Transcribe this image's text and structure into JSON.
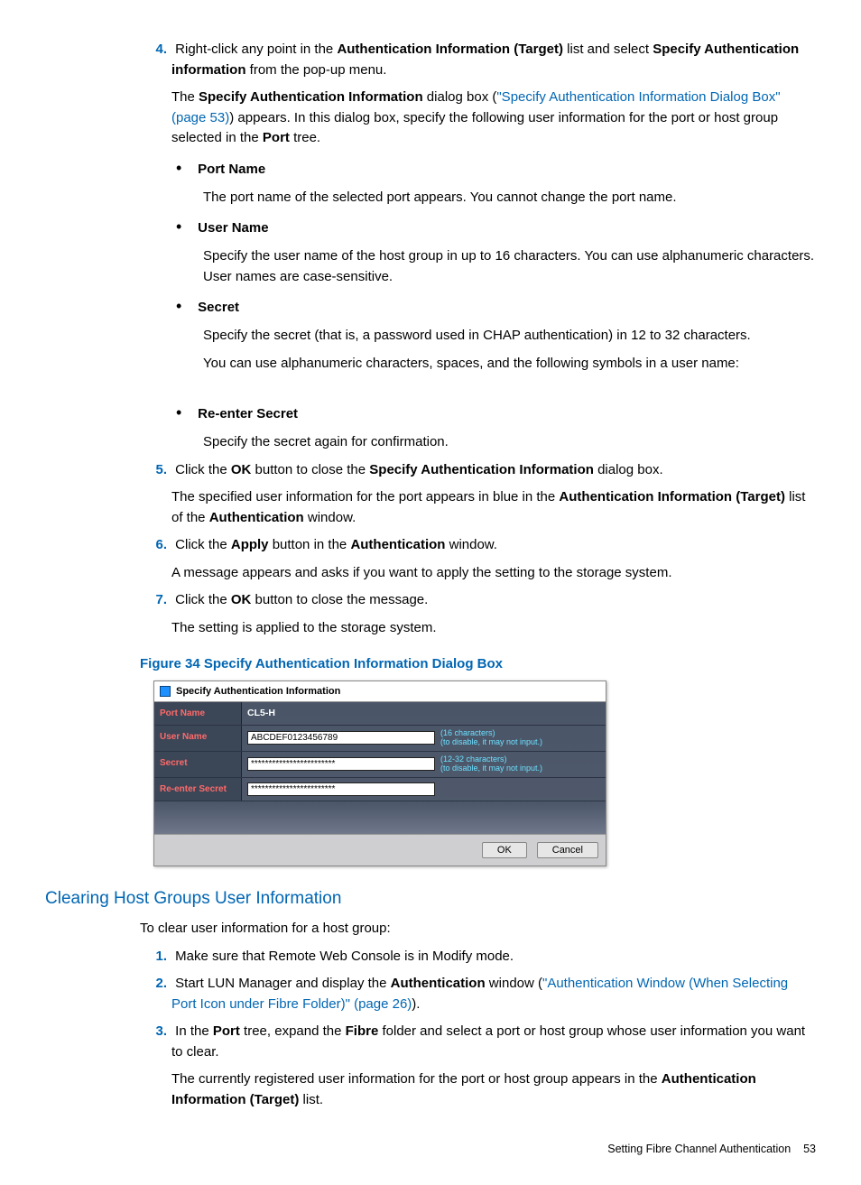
{
  "steps": {
    "s4": {
      "num": "4.",
      "line1a": "Right-click any point in the ",
      "line1b": "Authentication Information (Target)",
      "line1c": " list and select ",
      "line1d": "Specify Authentication information",
      "line1e": " from the pop-up menu.",
      "line2a": "The ",
      "line2b": "Specify Authentication Information",
      "line2c": " dialog box (",
      "link": "\"Specify Authentication Information Dialog Box\" (page 53)",
      "line2d": ") appears. In this dialog box, specify the following user information for the port or host group selected in the ",
      "line2e": "Port",
      "line2f": " tree."
    },
    "bullets": {
      "b1": {
        "t": "Port Name",
        "d": "The port name of the selected port appears. You cannot change the port name."
      },
      "b2": {
        "t": "User Name",
        "d": "Specify the user name of the host group in up to 16 characters. You can use alphanumeric characters. User names are case-sensitive."
      },
      "b3": {
        "t": "Secret",
        "d1": "Specify the secret (that is, a password used in CHAP authentication) in 12 to 32 characters.",
        "d2": "You can use alphanumeric characters, spaces, and the following symbols in a user name:"
      },
      "b4": {
        "t": "Re-enter Secret",
        "d": "Specify the secret again for confirmation."
      }
    },
    "s5": {
      "num": "5.",
      "l1a": "Click the ",
      "l1b": "OK",
      "l1c": " button to close the ",
      "l1d": "Specify Authentication Information",
      "l1e": " dialog box.",
      "l2a": "The specified user information for the port appears in blue in the ",
      "l2b": "Authentication Information (Target)",
      "l2c": " list of the ",
      "l2d": "Authentication",
      "l2e": " window."
    },
    "s6": {
      "num": "6.",
      "l1a": "Click the ",
      "l1b": "Apply",
      "l1c": " button in the ",
      "l1d": "Authentication",
      "l1e": " window.",
      "l2": "A message appears and asks if you want to apply the setting to the storage system."
    },
    "s7": {
      "num": "7.",
      "l1a": "Click the ",
      "l1b": "OK",
      "l1c": " button to close the message.",
      "l2": "The setting is applied to the storage system."
    }
  },
  "figure": {
    "caption": "Figure 34 Specify Authentication Information Dialog Box"
  },
  "dialog": {
    "title": "Specify Authentication Information",
    "rows": {
      "port": {
        "label": "Port Name",
        "value": "CL5-H"
      },
      "user": {
        "label": "User Name",
        "value": "ABCDEF0123456789",
        "hint1": "(16 characters)",
        "hint2": "(to disable, it may not input.)"
      },
      "secret": {
        "label": "Secret",
        "value": "************************",
        "hint1": "(12-32 characters)",
        "hint2": "(to disable, it may not input.)"
      },
      "reenter": {
        "label": "Re-enter Secret",
        "value": "************************"
      }
    },
    "ok": "OK",
    "cancel": "Cancel"
  },
  "section2": {
    "heading": "Clearing Host Groups User Information",
    "intro": "To clear user information for a host group:",
    "s1": {
      "num": "1.",
      "t": "Make sure that Remote Web Console is in Modify mode."
    },
    "s2": {
      "num": "2.",
      "a": "Start LUN Manager and display the ",
      "b": "Authentication",
      "c": " window (",
      "link": "\"Authentication Window (When Selecting Port Icon under Fibre Folder)\" (page 26)",
      "d": ")."
    },
    "s3": {
      "num": "3.",
      "a": "In the ",
      "b": "Port",
      "c": " tree, expand the ",
      "d": "Fibre",
      "e": " folder and select a port or host group whose user information you want to clear.",
      "l2a": "The currently registered user information for the port or host group appears in the ",
      "l2b": "Authentication Information (Target)",
      "l2c": " list."
    }
  },
  "footer": {
    "text": "Setting Fibre Channel Authentication",
    "page": "53"
  }
}
